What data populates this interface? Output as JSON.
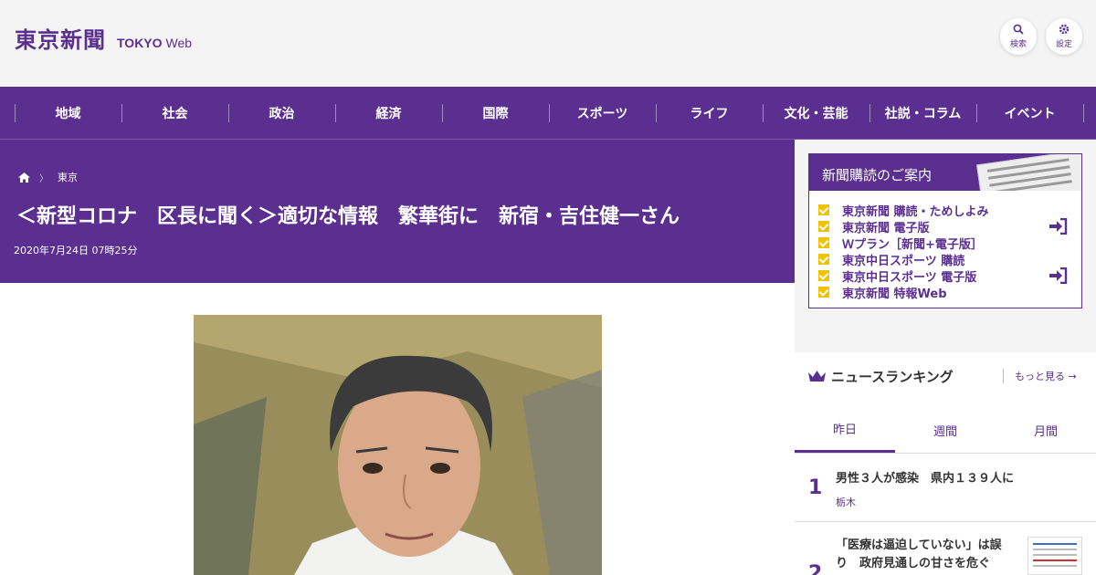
{
  "header": {
    "logo_jp": "東京新聞",
    "logo_en_bold": "TOKYO",
    "logo_en_light": "Web",
    "search_label": "検索",
    "settings_label": "設定"
  },
  "nav": {
    "items": [
      "地域",
      "社会",
      "政治",
      "経済",
      "国際",
      "スポーツ",
      "ライフ",
      "文化・芸能",
      "社説・コラム",
      "イベント"
    ]
  },
  "article": {
    "breadcrumb_home_icon": "home-icon",
    "breadcrumb_section": "東京",
    "title": "＜新型コロナ　区長に聞く＞適切な情報　繁華街に　新宿・吉住健一さん",
    "date": "2020年7月24日 07時25分"
  },
  "subscription": {
    "heading": "新聞購読のご案内",
    "items": [
      "東京新聞 購読・ためしよみ",
      "東京新聞 電子版",
      "Ｗプラン［新聞+電子版］",
      "東京中日スポーツ 購読",
      "東京中日スポーツ 電子版",
      "東京新聞 特報Web"
    ]
  },
  "ranking": {
    "heading": "ニュースランキング",
    "more_label": "もっと見る",
    "tabs": [
      "昨日",
      "週間",
      "月間"
    ],
    "items": [
      {
        "rank": "1",
        "title": "男性３人が感染　県内１３９人に",
        "category": "栃木"
      },
      {
        "rank": "2",
        "title_line1": "「医療は逼迫していない」は誤",
        "title_line2": "り　政府見通しの甘さを危ぐ"
      }
    ]
  },
  "colors": {
    "brand_purple": "#5a2f8f",
    "check_yellow": "#f2c200"
  }
}
